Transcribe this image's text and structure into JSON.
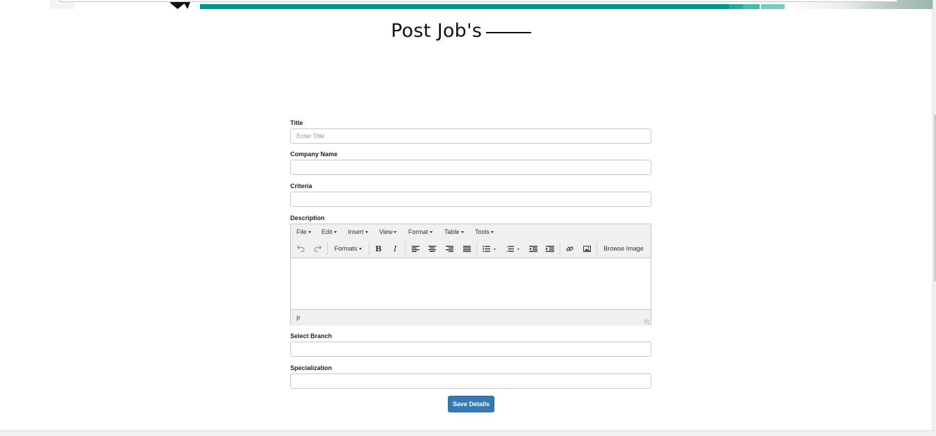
{
  "page": {
    "heading": "Post Job's"
  },
  "form": {
    "title": {
      "label": "Title",
      "placeholder": "Enter Title",
      "value": ""
    },
    "company": {
      "label": "Company Name",
      "value": ""
    },
    "criteria": {
      "label": "Criteria",
      "value": ""
    },
    "description": {
      "label": "Description",
      "menus": [
        "File",
        "Edit",
        "Insert",
        "View",
        "Format",
        "Table",
        "Tools"
      ],
      "toolbar": {
        "formats_label": "Formats",
        "browse_image_label": "Browse Image",
        "icons": [
          "undo-icon",
          "redo-icon",
          "bold-icon",
          "italic-icon",
          "align-left-icon",
          "align-center-icon",
          "align-right-icon",
          "align-justify-icon",
          "bullet-list-icon",
          "numbered-list-icon",
          "outdent-icon",
          "indent-icon",
          "link-icon",
          "image-icon"
        ]
      },
      "status_path": "p"
    },
    "branch": {
      "label": "Select Branch",
      "value": ""
    },
    "specialization": {
      "label": "Specialization",
      "value": ""
    },
    "submit_label": "Save Details"
  },
  "colors": {
    "primary_button": "#337ab7",
    "banner_teal": "#00939a"
  }
}
